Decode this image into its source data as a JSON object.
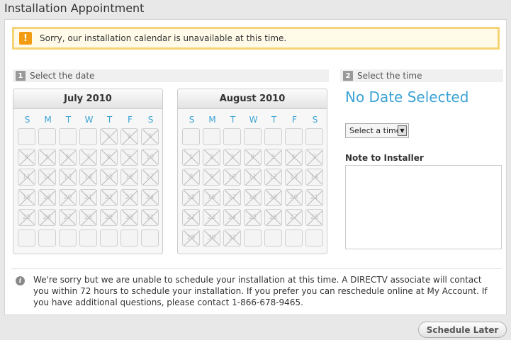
{
  "page": {
    "title": "Installation Appointment"
  },
  "alert": {
    "icon": "warning-icon",
    "text": "Sorry, our installation calendar is unavailable at this time."
  },
  "steps": {
    "date": {
      "number": "1",
      "label": "Select the date"
    },
    "time": {
      "number": "2",
      "label": "Select the time"
    }
  },
  "calendars": {
    "july": {
      "title": "July 2010",
      "weekdays": [
        "S",
        "M",
        "T",
        "W",
        "T",
        "F",
        "S"
      ],
      "weeks": [
        [
          null,
          null,
          null,
          null,
          "1",
          "2",
          "3"
        ],
        [
          "4",
          "5",
          "6",
          "7",
          "8",
          "9",
          "10"
        ],
        [
          "11",
          "12",
          "13",
          "14",
          "15",
          "16",
          "17"
        ],
        [
          "18",
          "19",
          "20",
          "21",
          "22",
          "23",
          "24"
        ],
        [
          "25",
          "26",
          "27",
          "28",
          "29",
          "30",
          "31"
        ],
        [
          null,
          null,
          null,
          null,
          null,
          null,
          null
        ]
      ]
    },
    "august": {
      "title": "August 2010",
      "weekdays": [
        "S",
        "M",
        "T",
        "W",
        "T",
        "F",
        "S"
      ],
      "weeks": [
        [
          null,
          null,
          null,
          null,
          null,
          null,
          null
        ],
        [
          "1",
          "2",
          "3",
          "4",
          "5",
          "6",
          "7"
        ],
        [
          "8",
          "9",
          "10",
          "11",
          "12",
          "13",
          "14"
        ],
        [
          "15",
          "16",
          "17",
          "18",
          "19",
          "20",
          "21"
        ],
        [
          "22",
          "23",
          "24",
          "25",
          "26",
          "27",
          "28"
        ],
        [
          "29",
          "30",
          "31",
          null,
          null,
          null,
          null
        ]
      ]
    }
  },
  "time_panel": {
    "selected_date": "No Date Selected",
    "time_select": {
      "value": "Select a time"
    },
    "note_label": "Note to Installer",
    "note_value": ""
  },
  "info": {
    "icon": "info-icon",
    "text": "We're sorry but we are unable to schedule your installation at this time. A DIRECTV associate will contact you within 72 hours to schedule your installation. If you prefer you can reschedule online at My Account. If you have additional questions, please contact 1-866-678-9465."
  },
  "actions": {
    "schedule_later": "Schedule Later"
  },
  "colors": {
    "accent": "#3ba3d5",
    "alert_border": "#f6d475",
    "alert_icon": "#f39c12"
  }
}
